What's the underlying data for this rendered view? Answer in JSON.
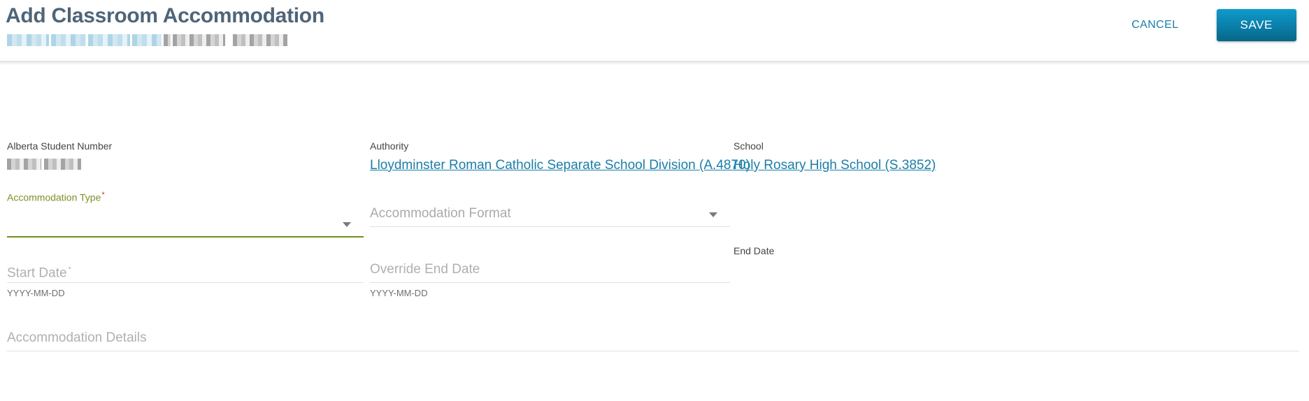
{
  "header": {
    "title": "Add Classroom Accommodation",
    "subtitle_redacted": true,
    "cancel_label": "CANCEL",
    "save_label": "SAVE",
    "link_color": "#1b7ea8",
    "save_gradient_top": "#0f9bc9",
    "save_gradient_bottom": "#076687",
    "title_color": "#4e6579"
  },
  "form": {
    "student_number": {
      "label": "Alberta Student Number",
      "value": "",
      "redacted": true
    },
    "authority": {
      "label": "Authority",
      "value": "Lloydminster Roman Catholic Separate School Division (A.4870)"
    },
    "school": {
      "label": "School",
      "value": "Holy Rosary High School (S.3852)"
    },
    "accommodation_type": {
      "label": "Accommodation Type",
      "required": true,
      "required_marker": "*",
      "value": "",
      "focused": true,
      "focus_color": "#6f8f1e"
    },
    "accommodation_format": {
      "label": "",
      "placeholder": "Accommodation Format",
      "value": ""
    },
    "start_date": {
      "placeholder": "Start Date",
      "required_marker": "*",
      "value": "",
      "hint": "YYYY-MM-DD"
    },
    "override_end_date": {
      "placeholder": "Override End Date",
      "value": "",
      "hint": "YYYY-MM-DD"
    },
    "end_date": {
      "label": "End Date",
      "value": ""
    },
    "accommodation_details": {
      "placeholder": "Accommodation Details",
      "value": ""
    }
  }
}
